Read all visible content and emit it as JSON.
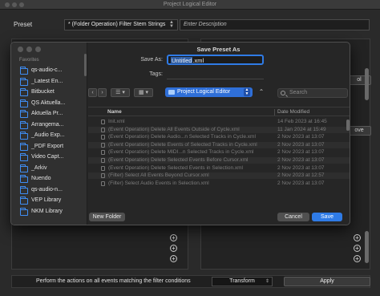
{
  "window": {
    "title": "Project Logical Editor"
  },
  "preset": {
    "label": "Preset",
    "value": "* (Folder Operation) Filter Stem Strings",
    "description_placeholder": "Enter Description"
  },
  "background": {
    "side_buttons": [
      "ol",
      "ove"
    ],
    "bottom_text": "Perform the actions on all events matching the filter conditions",
    "transform_label": "Transform",
    "apply_label": "Apply"
  },
  "dialog": {
    "title": "Save Preset As",
    "save_as_label": "Save As:",
    "save_as_value_selected": "Untitled",
    "save_as_value_ext": ".xml",
    "tags_label": "Tags:",
    "location": "Project Logical Editor",
    "search_placeholder": "Search",
    "sidebar": {
      "header": "Favorites",
      "items": [
        "qs-audio-c...",
        "_Latest En...",
        "Bitbucket",
        "QS Aktuella...",
        "Aktuella Pr...",
        "Arrangema...",
        "_Audio Exp...",
        "_PDF Export",
        "Video Capt...",
        "_Arkiv",
        "Nuendo",
        "qs-audio-n...",
        "VEP Library",
        "NKM Library"
      ]
    },
    "columns": {
      "name": "Name",
      "date": "Date Modified"
    },
    "files": [
      {
        "name": "Init.xml",
        "date": "14 Feb 2023 at 16:45"
      },
      {
        "name": "(Event Operation) Delete All Events Outside of Cycle.xml",
        "date": "11 Jan 2024 at 15:49"
      },
      {
        "name": "(Event Operation) Delete Audio...n Selected Tracks in Cycle.xml",
        "date": "2 Nov 2023 at 13:07"
      },
      {
        "name": "(Event Operation) Delete Events of Selected Tracks in Cycle.xml",
        "date": "2 Nov 2023 at 13:07"
      },
      {
        "name": "(Event Operation) Delete MIDI...n Selected Tracks in Cycle.xml",
        "date": "2 Nov 2023 at 13:07"
      },
      {
        "name": "(Event Operation) Delete Selected Events Before Cursor.xml",
        "date": "2 Nov 2023 at 13:07"
      },
      {
        "name": "(Event Operation) Delete Selected Events in Selection.xml",
        "date": "2 Nov 2023 at 13:07"
      },
      {
        "name": "(Filter) Select All Events Beyond Cursor.xml",
        "date": "2 Nov 2023 at 12:57"
      },
      {
        "name": "(Filter) Select Audio Events in Selection.xml",
        "date": "2 Nov 2023 at 13:07"
      }
    ],
    "new_folder_label": "New Folder",
    "cancel_label": "Cancel",
    "save_label": "Save"
  }
}
